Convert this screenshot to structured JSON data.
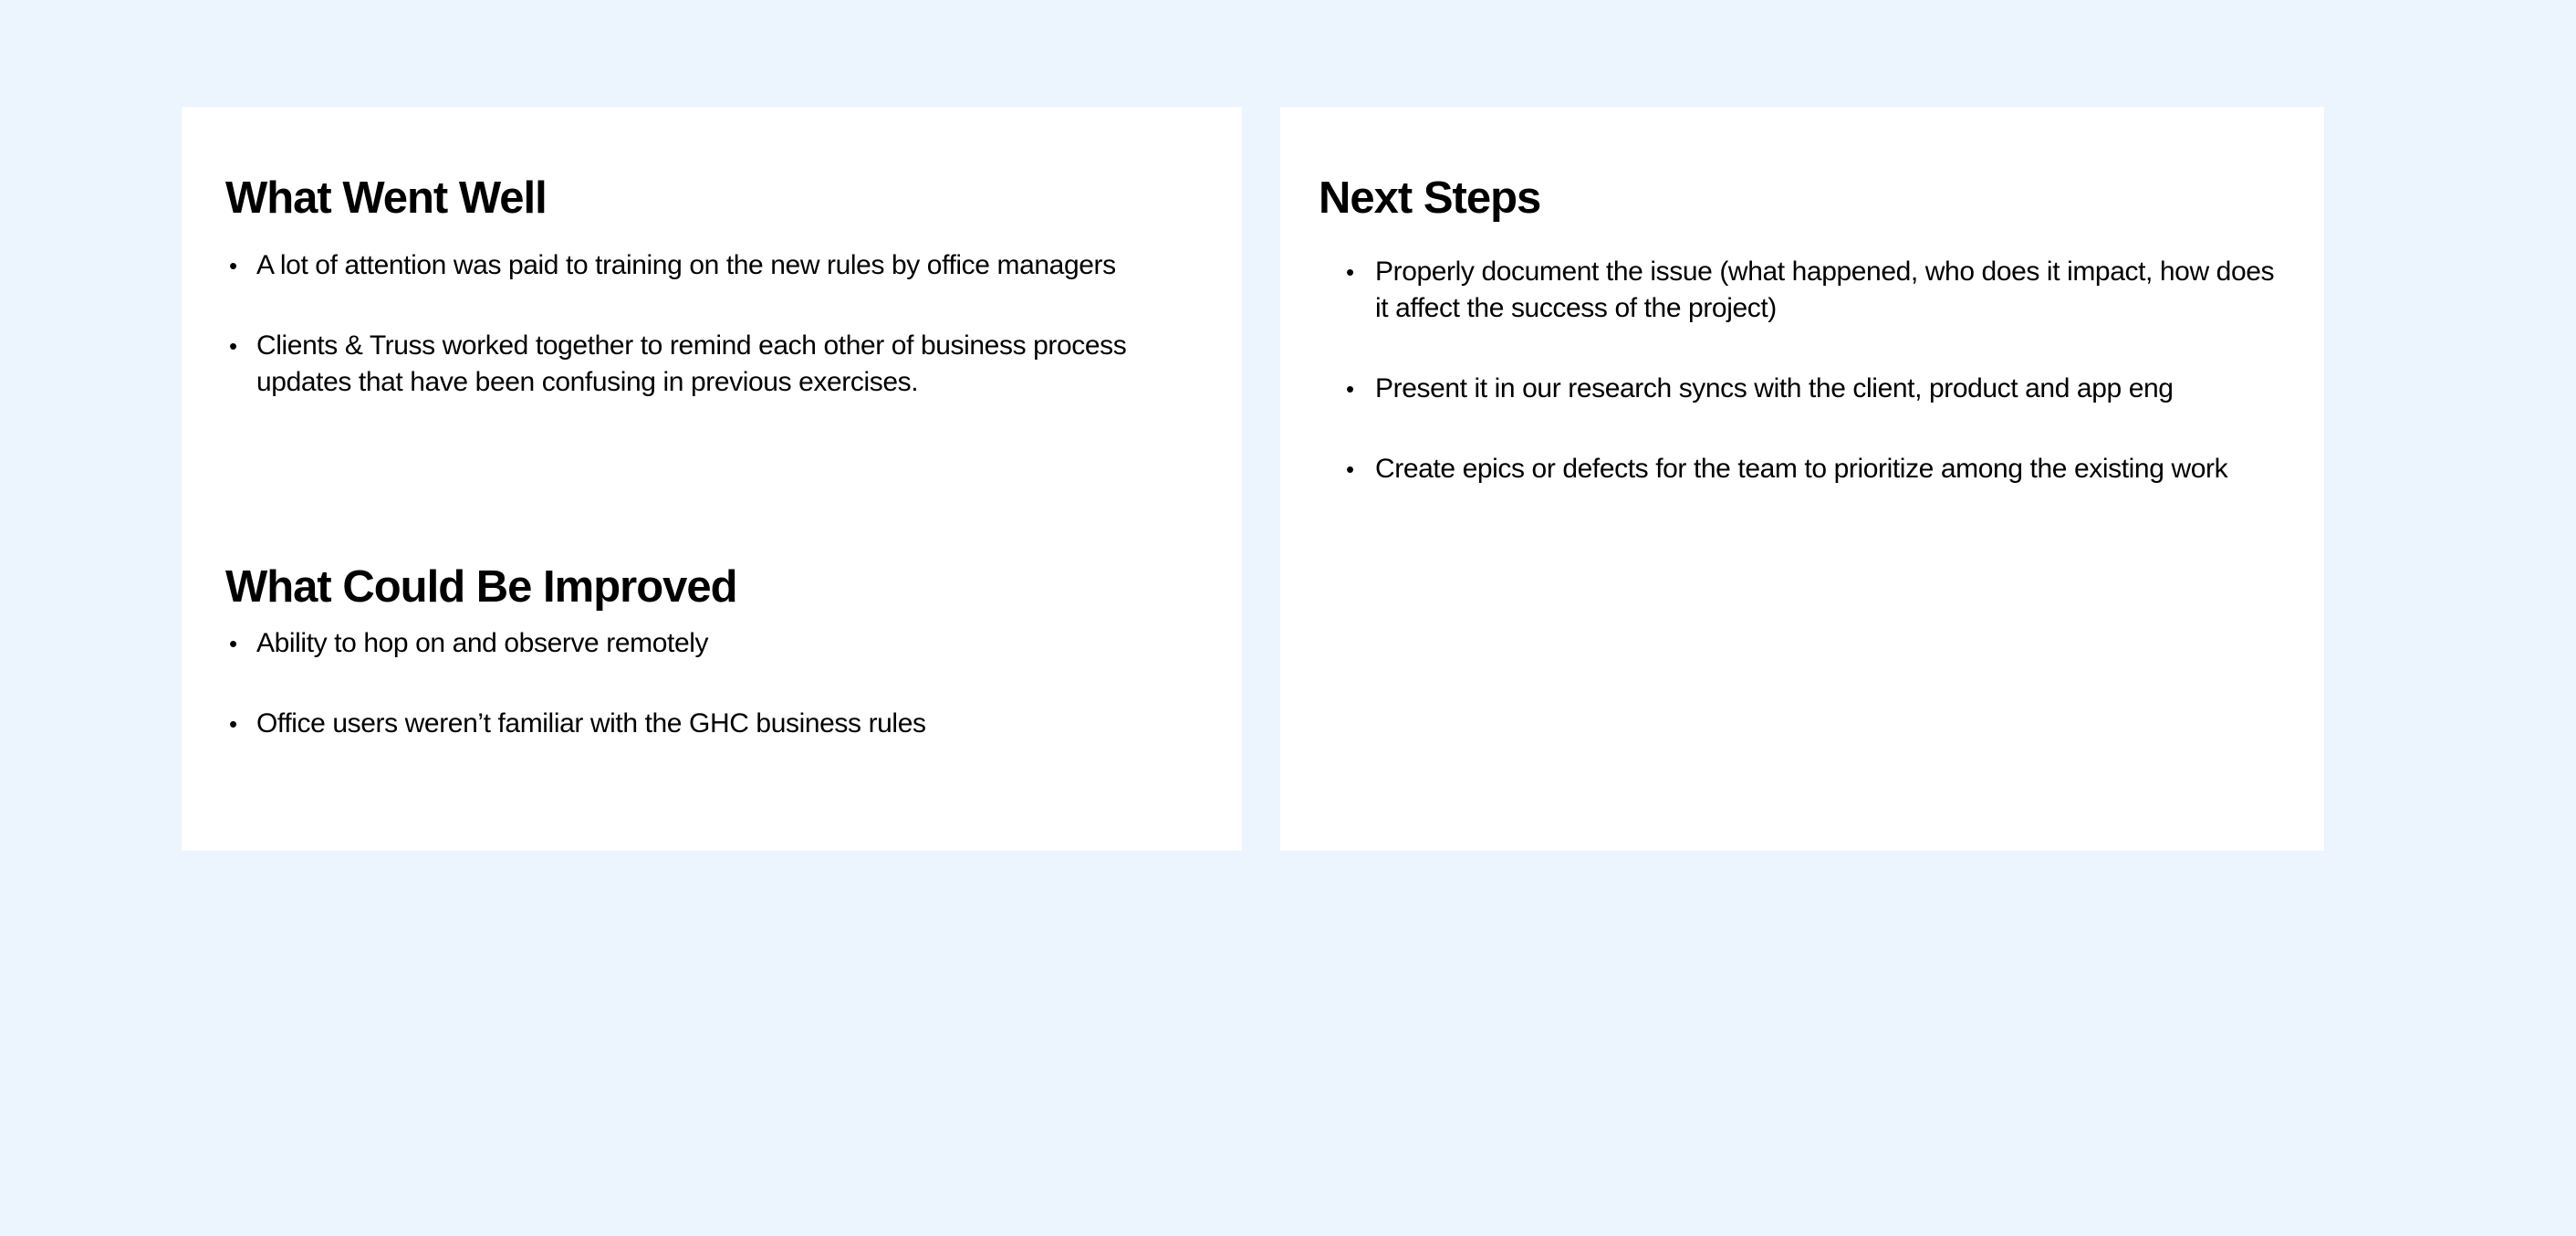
{
  "what_went_well": {
    "title": "What Went Well",
    "items": [
      "A lot of attention was paid to training on the new rules by office managers",
      "Clients & Truss worked together to remind each other of business process updates that have been confusing in previous exercises."
    ]
  },
  "what_could_be_improved": {
    "title": "What Could Be Improved",
    "items": [
      "Ability to hop on and observe remotely",
      "Office users weren’t familiar with the GHC business rules"
    ]
  },
  "next_steps": {
    "title": "Next Steps",
    "items": [
      "Properly document the issue (what happened, who does it impact, how does it affect the success of the project)",
      "Present it in our research syncs with the client, product and app eng",
      "Create epics or defects for the team to prioritize among the existing work"
    ]
  },
  "colors": {
    "background": "#ecf4fe",
    "card": "#ffffff",
    "text": "#000000"
  }
}
